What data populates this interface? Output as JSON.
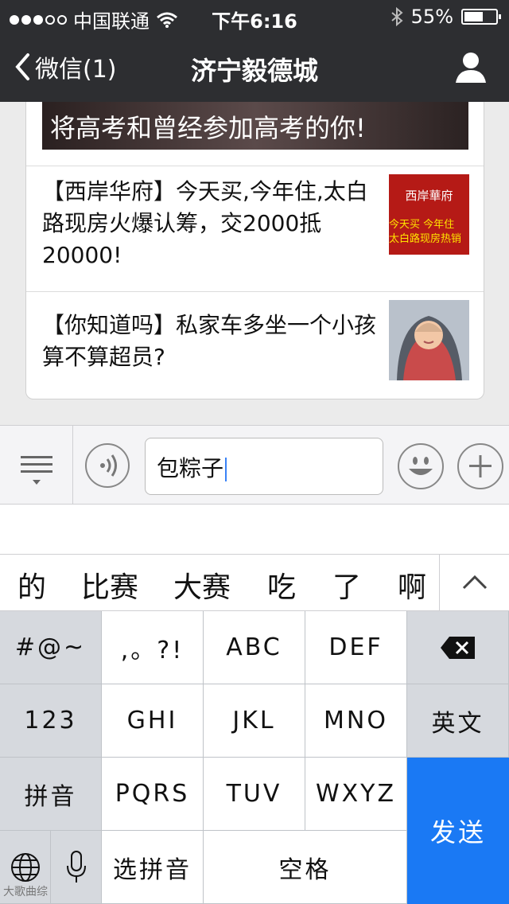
{
  "status_bar": {
    "carrier": "中国联通",
    "time": "下午6:16",
    "battery": "55%",
    "signal_strength": 3,
    "battery_level": 0.55
  },
  "nav": {
    "back_label": "微信(1)",
    "title": "济宁毅德城",
    "icons": {
      "back": "chevron-left-icon",
      "profile": "person-icon"
    }
  },
  "articles": {
    "banner_text": "将高考和曾经参加高考的你!",
    "items": [
      {
        "title": "【西岸华府】今天买,今年住,太白路现房火爆认筹，交2000抵20000!",
        "thumb": {
          "brand": "西岸華府",
          "line1": "今天买  今年住",
          "line2": "太白路现房热销"
        }
      },
      {
        "title": "【你知道吗】私家车多坐一个小孩算不算超员?"
      }
    ]
  },
  "input_bar": {
    "text_value": "包粽子",
    "icons": [
      "menu-list-icon",
      "voice-icon",
      "emoji-icon",
      "plus-icon"
    ]
  },
  "candidates": {
    "items": [
      "的",
      "比赛",
      "大赛",
      "吃",
      "了",
      "啊"
    ],
    "expand_icon": "chevron-up-icon"
  },
  "keyboard": {
    "symbols": "#@~",
    "punct": ",。?!",
    "abc": "ABC",
    "def": "DEF",
    "delete_icon": "backspace-icon",
    "num": "123",
    "ghi": "GHI",
    "jkl": "JKL",
    "mno": "MNO",
    "english": "英文",
    "pinyin": "拼音",
    "pqrs": "PQRS",
    "tuv": "TUV",
    "wxyz": "WXYZ",
    "send": "发送",
    "globe_icon": "globe-icon",
    "mic_icon": "microphone-icon",
    "select_pinyin": "选拼音",
    "space": "空格"
  },
  "watermark": "大歌曲综"
}
